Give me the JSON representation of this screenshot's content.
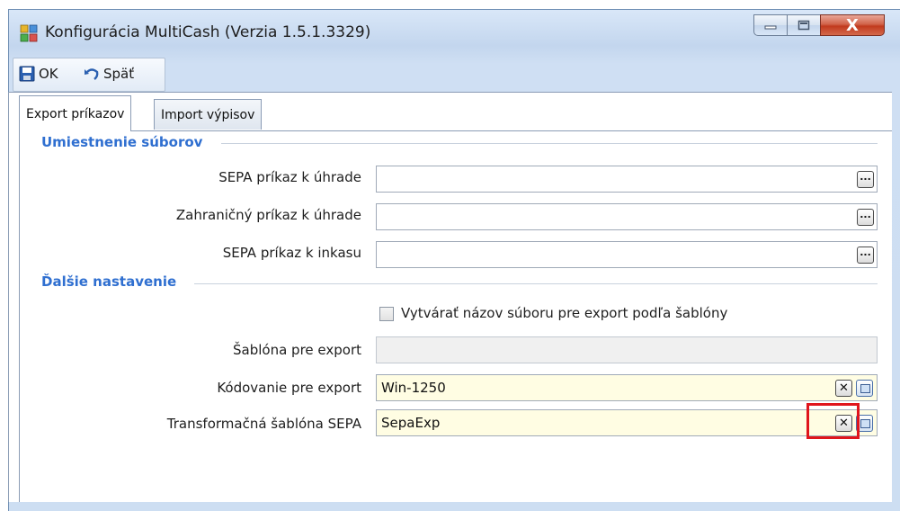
{
  "window": {
    "title": "Konfigurácia MultiCash (Verzia 1.5.1.3329)",
    "controls": {
      "minimize_icon": "minimize-icon",
      "maximize_icon": "maximize-icon",
      "close_label": "X"
    }
  },
  "toolbar": {
    "ok_label": "OK",
    "back_label": "Späť"
  },
  "tabs": [
    {
      "label": "Export príkazov",
      "active": true
    },
    {
      "label": "Import výpisov",
      "active": false
    }
  ],
  "groups": {
    "file_location": "Umiestnenie súborov",
    "other_settings": "Ďalšie nastavenie"
  },
  "fields": {
    "sepa_transfer": {
      "label": "SEPA príkaz k úhrade",
      "value": ""
    },
    "foreign_transfer": {
      "label": "Zahraničný príkaz k úhrade",
      "value": ""
    },
    "sepa_collection": {
      "label": "SEPA príkaz k inkasu",
      "value": ""
    },
    "template_checkbox": {
      "label": "Vytvárať názov súboru pre export podľa šablóny",
      "checked": false
    },
    "export_template": {
      "label": "Šablóna pre export",
      "value": ""
    },
    "export_encoding": {
      "label": "Kódovanie pre export",
      "value": "Win-1250"
    },
    "sepa_transform": {
      "label": "Transformačná šablóna SEPA",
      "value": "SepaExp"
    }
  },
  "buttons": {
    "browse_label": "...",
    "clear_label": "✕"
  },
  "colors": {
    "group_title": "#2f6fd0",
    "highlight": "#e0151c",
    "field_yellow": "#fffde3"
  }
}
